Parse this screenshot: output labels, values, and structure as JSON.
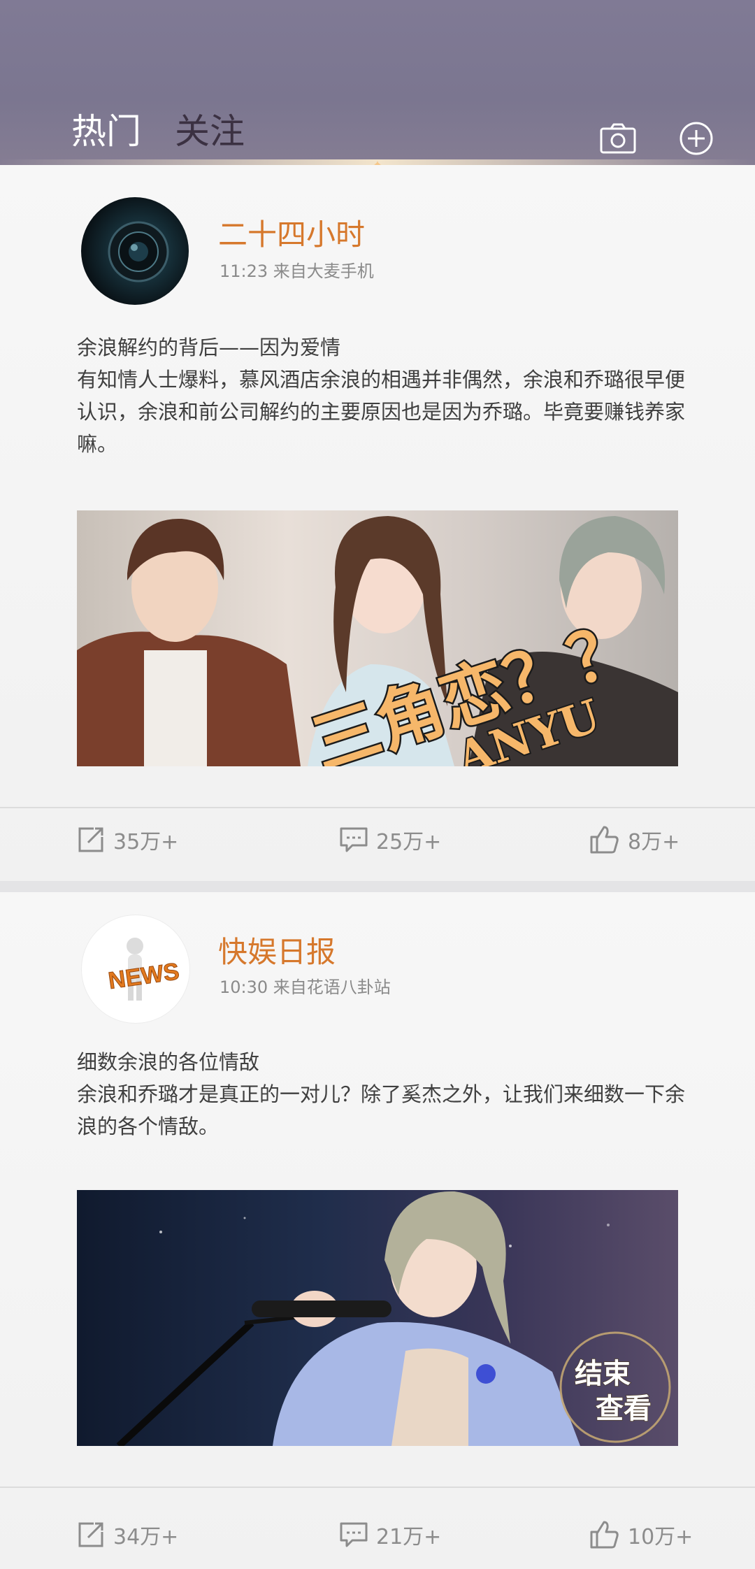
{
  "header": {
    "tabs": [
      {
        "label": "热门",
        "active": true
      },
      {
        "label": "关注",
        "active": false
      }
    ]
  },
  "posts": [
    {
      "author": "二十四小时",
      "meta": "11:23 来自大麦手机",
      "title": "余浪解约的背后——因为爱情",
      "body": "有知情人士爆料，慕风酒店余浪的相遇并非偶然，余浪和乔璐很早便认识，余浪和前公司解约的主要原因也是因为乔璐。毕竟要赚钱养家嘛。",
      "image_text": "三角恋？？",
      "image_text2": "ANYU",
      "share": "35万+",
      "comments": "25万+",
      "likes": "8万+"
    },
    {
      "author": "快娱日报",
      "meta": "10:30 来自花语八卦站",
      "avatar_text": "NEWS",
      "title": "细数余浪的各位情敌",
      "body": "余浪和乔璐才是真正的一对儿？除了奚杰之外，让我们来细数一下余浪的各个情敌。",
      "stamp_line1": "结束",
      "stamp_line2": "查看",
      "share": "34万+",
      "comments": "21万+",
      "likes": "10万+"
    }
  ],
  "colors": {
    "header": "#7d7892",
    "author": "#d6782c",
    "accent": "#f1a23c"
  },
  "icons": [
    "camera-icon",
    "plus-circle-icon",
    "share-icon",
    "comment-icon",
    "thumbs-up-icon"
  ]
}
